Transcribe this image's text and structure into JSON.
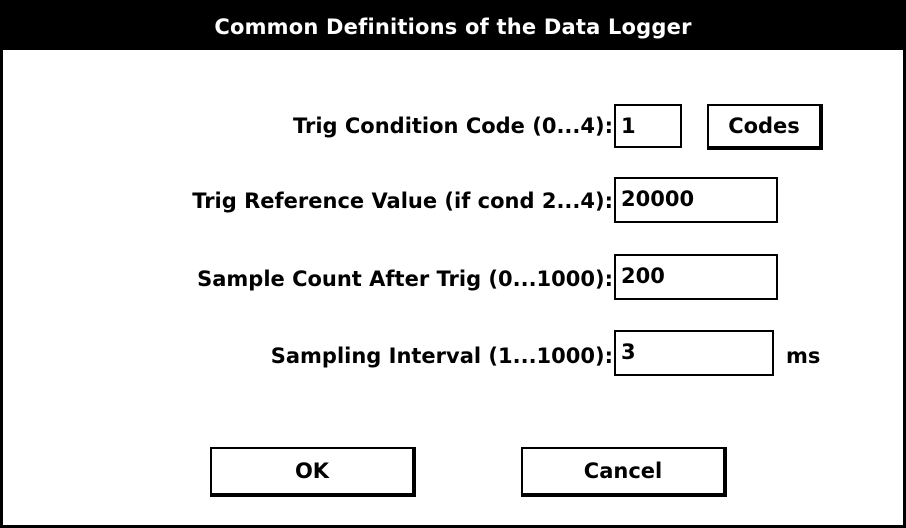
{
  "window": {
    "title": "Common Definitions of the Data Logger"
  },
  "fields": [
    {
      "label": "Trig Condition Code (0...4):",
      "value": "1"
    },
    {
      "label": "Trig Reference Value (if cond 2...4):",
      "value": "20000"
    },
    {
      "label": "Sample Count After Trig (0...1000):",
      "value": "200"
    },
    {
      "label": "Sampling Interval (1...1000):",
      "value": "3",
      "unit": "ms"
    }
  ],
  "buttons": {
    "codes_label": "Codes",
    "ok_label": "OK",
    "cancel_label": "Cancel"
  }
}
